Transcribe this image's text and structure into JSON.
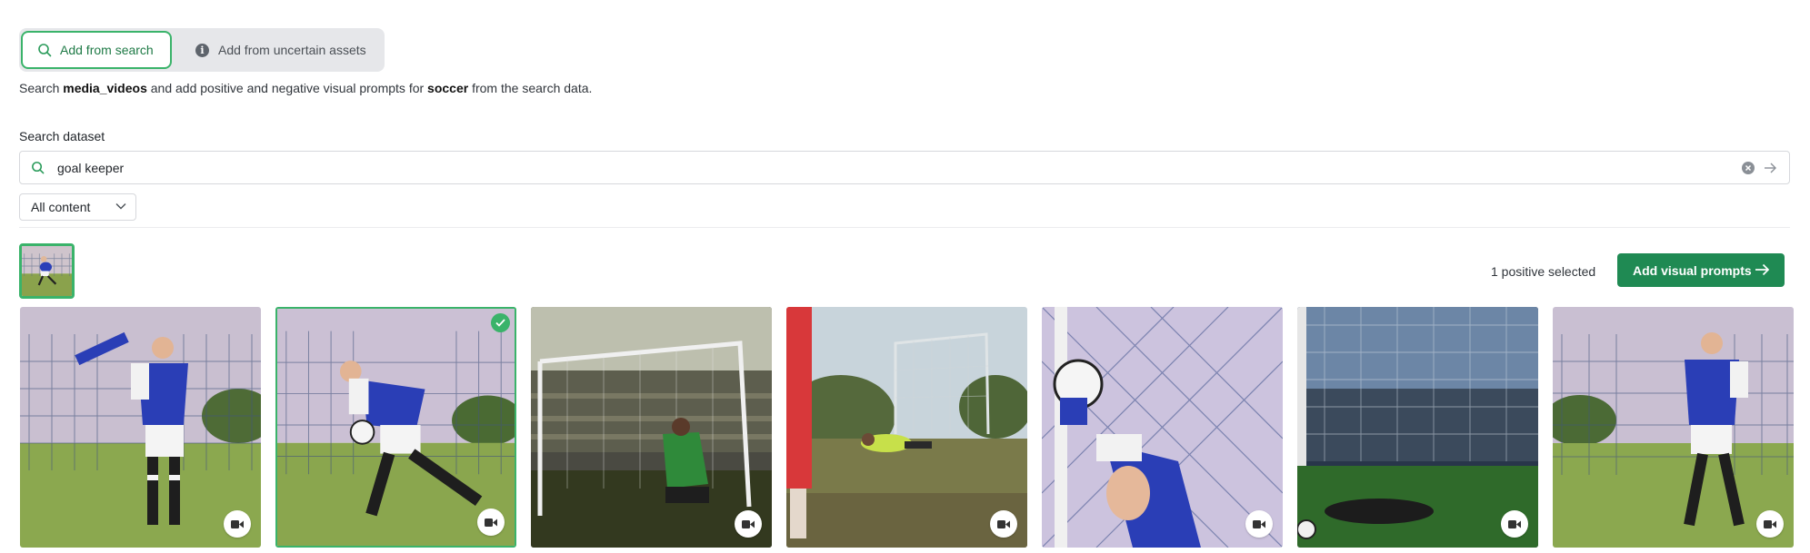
{
  "tabs": {
    "search_label": "Add from search",
    "uncertain_label": "Add from uncertain assets"
  },
  "description": {
    "prefix": "Search ",
    "dataset": "media_videos",
    "middle": " and add positive and negative visual prompts for ",
    "concept": "soccer",
    "suffix": " from the search data."
  },
  "search": {
    "label": "Search dataset",
    "value": "goal keeper"
  },
  "filter": {
    "selected": "All content"
  },
  "selection": {
    "count_text": "1 positive selected",
    "add_button_label": "Add visual prompts"
  },
  "results": [
    {
      "type": "video",
      "selected": false,
      "scene": "keeper-net-throw"
    },
    {
      "type": "video",
      "selected": true,
      "scene": "keeper-net-ball"
    },
    {
      "type": "video",
      "selected": false,
      "scene": "stadium-keeper-crouch"
    },
    {
      "type": "video",
      "selected": false,
      "scene": "keeper-dive-field"
    },
    {
      "type": "video",
      "selected": false,
      "scene": "keeper-catch-closeup"
    },
    {
      "type": "video",
      "selected": false,
      "scene": "stadium-keeper-dive"
    },
    {
      "type": "video",
      "selected": false,
      "scene": "keeper-net-ready"
    }
  ],
  "colors": {
    "accent": "#3ab36a",
    "button": "#1f8a53"
  },
  "icons": {
    "tab_search": "search-icon",
    "tab_uncertain": "info-icon",
    "search": "search-icon",
    "clear": "clear-icon",
    "submit": "arrow-right-icon",
    "filter": "chevron-down-icon",
    "card_type": "video-camera-icon",
    "card_selected": "check-icon"
  }
}
